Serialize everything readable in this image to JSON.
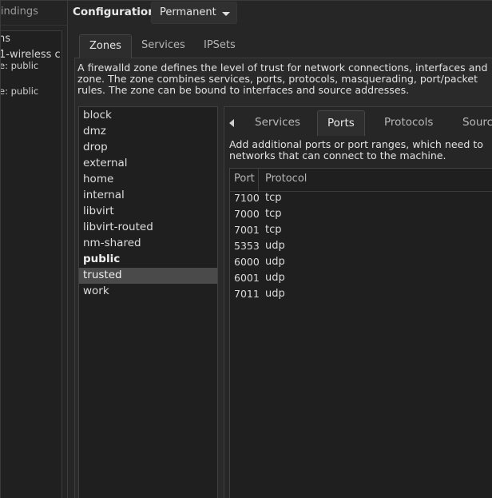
{
  "left_panel": {
    "header": "Bindings",
    "lines": [
      "ns",
      "1-wireless c",
      "e: public",
      "e: public"
    ]
  },
  "configuration": {
    "label": "Configuration:",
    "value": "Permanent"
  },
  "top_tabs": [
    {
      "label": "Zones",
      "active": true
    },
    {
      "label": "Services",
      "active": false
    },
    {
      "label": "IPSets",
      "active": false
    }
  ],
  "zones_description": [
    "A firewalld zone defines the level of trust for network connections, interfaces and",
    "zone. The zone combines services, ports, protocols, masquerading, port/packet",
    "rules. The zone can be bound to interfaces and source addresses."
  ],
  "zones": [
    {
      "name": "block"
    },
    {
      "name": "dmz"
    },
    {
      "name": "drop"
    },
    {
      "name": "external"
    },
    {
      "name": "home"
    },
    {
      "name": "internal"
    },
    {
      "name": "libvirt"
    },
    {
      "name": "libvirt-routed"
    },
    {
      "name": "nm-shared"
    },
    {
      "name": "public",
      "bold": true
    },
    {
      "name": "trusted",
      "selected": true
    },
    {
      "name": "work"
    }
  ],
  "inner_tabs": [
    {
      "label": "Services",
      "active": false
    },
    {
      "label": "Ports",
      "active": true
    },
    {
      "label": "Protocols",
      "active": false
    },
    {
      "label": "Sourc",
      "active": false
    }
  ],
  "ports_description": [
    "Add additional ports or port ranges, which need to",
    "networks that can connect to the machine."
  ],
  "ports_table": {
    "headers": {
      "port": "Port",
      "protocol": "Protocol"
    },
    "rows": [
      {
        "port": "7100",
        "protocol": "tcp"
      },
      {
        "port": "7000",
        "protocol": "tcp"
      },
      {
        "port": "7001",
        "protocol": "tcp"
      },
      {
        "port": "5353",
        "protocol": "udp"
      },
      {
        "port": "6000",
        "protocol": "udp"
      },
      {
        "port": "6001",
        "protocol": "udp"
      },
      {
        "port": "7011",
        "protocol": "udp"
      }
    ]
  }
}
